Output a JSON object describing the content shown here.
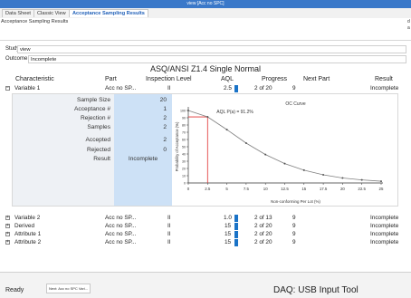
{
  "window": {
    "title": "view [Acc no SPC]"
  },
  "tabs": [
    {
      "label": "Data Sheet"
    },
    {
      "label": "Classic View"
    },
    {
      "label": "Acceptance Sampling Results"
    }
  ],
  "page_subtitle": "Acceptance Sampling Results",
  "edge_glyphs": [
    "d",
    "a"
  ],
  "fields": {
    "study_label": "Study",
    "study_value": "view",
    "outcome_label": "Outcome",
    "outcome_value": "Incomplete"
  },
  "standard_title": "ASQ/ANSI Z1.4 Single Normal",
  "columns": [
    "Characteristic",
    "Part",
    "Inspection Level",
    "AQL",
    "Progress",
    "Next Part",
    "Result"
  ],
  "rows": [
    {
      "expander": "−",
      "characteristic": "Variable 1",
      "part": "Acc no SP...",
      "level": "II",
      "aql": "2.5",
      "progress": "2 of 20",
      "next": "9",
      "result": "Incomplete"
    },
    {
      "expander": "+",
      "characteristic": "Variable 2",
      "part": "Acc no SP...",
      "level": "II",
      "aql": "1.0",
      "progress": "2 of 13",
      "next": "9",
      "result": "Incomplete"
    },
    {
      "expander": "+",
      "characteristic": "Derived",
      "part": "Acc no SP...",
      "level": "II",
      "aql": "15",
      "progress": "2 of 20",
      "next": "9",
      "result": "Incomplete"
    },
    {
      "expander": "+",
      "characteristic": "Attribute 1",
      "part": "Acc no SP...",
      "level": "II",
      "aql": "15",
      "progress": "2 of 20",
      "next": "9",
      "result": "Incomplete"
    },
    {
      "expander": "+",
      "characteristic": "Attribute 2",
      "part": "Acc no SP...",
      "level": "II",
      "aql": "15",
      "progress": "2 of 20",
      "next": "9",
      "result": "Incomplete"
    }
  ],
  "sampling": [
    {
      "label": "Sample Size",
      "value": "20"
    },
    {
      "label": "Acceptance #",
      "value": "1"
    },
    {
      "label": "Rejection #",
      "value": "2"
    },
    {
      "label": "Samples",
      "value": "2"
    },
    {
      "label": "Accepted",
      "value": "2"
    },
    {
      "label": "Rejected",
      "value": "0"
    },
    {
      "label": "Result",
      "value": "Incomplete"
    }
  ],
  "chart_data": {
    "type": "line",
    "title": "OC Curve",
    "xlabel": "Non-conforming Per Lot (%)",
    "ylabel": "Probability of Acceptance (%)",
    "xlim": [
      0,
      25
    ],
    "ylim": [
      0,
      100
    ],
    "x_ticks": [
      "0",
      "2.5",
      "5",
      "7.5",
      "10",
      "12.5",
      "15",
      "17.5",
      "20",
      "22.5",
      "25"
    ],
    "y_ticks": [
      "0",
      "10",
      "20",
      "30",
      "40",
      "50",
      "60",
      "70",
      "80",
      "90",
      "100"
    ],
    "grid": false,
    "series": [
      {
        "x": [
          0,
          2.5,
          5,
          7.5,
          10,
          12.5,
          15,
          17.5,
          20,
          22.5,
          25
        ],
        "y": [
          100,
          91.2,
          73.6,
          55.0,
          39.2,
          26.7,
          17.6,
          11.2,
          6.9,
          4.2,
          2.4
        ]
      }
    ],
    "annotation": {
      "text": "AQL P(a) = 91.2%",
      "x": 2.5,
      "y": 91.2
    },
    "aql_marker_x": 2.5,
    "colors": {
      "curve": "#7f7f7f",
      "marker": "#e03030",
      "axis": "#333333"
    }
  },
  "statusbar": {
    "ready": "Ready",
    "tab": "Next: Acc no SPC Vari...",
    "daq": "DAQ: USB Input Tool"
  },
  "colors": {
    "titlebar": "#3a78c9",
    "aql_bar": "#1a73c7",
    "panel_label_bg": "#eef1f5",
    "panel_value_bg": "#cde1f6"
  }
}
